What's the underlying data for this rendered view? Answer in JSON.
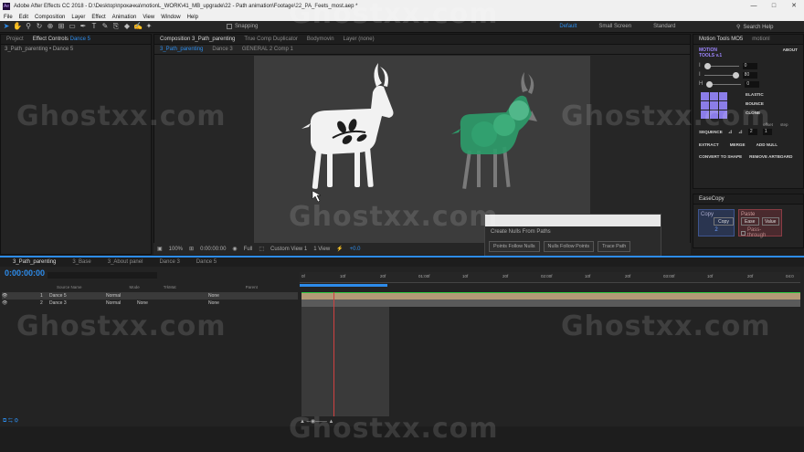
{
  "title_bar": {
    "app_icon": "Ae",
    "title": "Adobe After Effects CC 2018 - D:\\Desktop\\прокачка\\motionL_WORK\\41_MB_upgrade\\22 - Path animation\\Footage\\22_PA_Feets_most.aep *",
    "controls": [
      "—",
      "□",
      "✕"
    ]
  },
  "menu": [
    "File",
    "Edit",
    "Composition",
    "Layer",
    "Effect",
    "Animation",
    "View",
    "Window",
    "Help"
  ],
  "toolbar": {
    "snapping": "Snapping",
    "workspaces": [
      "Default",
      "Small Screen",
      "Standard"
    ],
    "active_workspace": "Default",
    "search_placeholder": "Search Help"
  },
  "project_panel": {
    "tab_project": "Project",
    "tab_effect_controls": "Effect Controls",
    "effect_controls_layer": "Dance 5",
    "breadcrumb": "3_Path_parenting • Dance 5"
  },
  "comp_panel": {
    "tabs": [
      "Composition 3_Path_parenting",
      "True Comp Duplicator",
      "Bodymovin",
      "Layer (none)"
    ],
    "subtabs": [
      "3_Path_parenting",
      "Dance 3",
      "GENERAL 2 Comp 1"
    ],
    "zoom": "100%",
    "timecode": "0:00:00:00",
    "resolution": "Full",
    "view": "Custom View 1",
    "views": "1 View",
    "exposure": "+0.0"
  },
  "motion_tools": {
    "tab": "Motion Tools MO5",
    "tab2": "motionl",
    "logo_line1": "MOTION",
    "logo_line2": "TOOLS v.1",
    "about": "ABOUT",
    "sliders": [
      {
        "label": "I",
        "value": "0"
      },
      {
        "label": "I",
        "value": "80"
      },
      {
        "label": "H",
        "value": "0"
      }
    ],
    "elastic": "ELASTIC",
    "bounce": "BOUNCE",
    "clone": "CLONE",
    "offset": "offset",
    "step": "step",
    "sequence": "SEQUENCE",
    "seq_v1": "2",
    "seq_v2": "1",
    "extract": "EXTRACT",
    "merge": "MERGE",
    "add_null": "ADD NULL",
    "convert": "CONVERT TO SHAPE",
    "remove_artboard": "REMOVE ARTBOARD"
  },
  "ease_copy": {
    "tab": "EaseCopy",
    "copy_title": "Copy",
    "copy_btn": "Copy",
    "copy_num": "2",
    "paste_title": "Paste",
    "ease_btn": "Ease",
    "value_btn": "Value",
    "pass_through": "Pass-through"
  },
  "nulls_dialog": {
    "title": "Create Nulls From Paths",
    "buttons": [
      "Points Follow Nulls",
      "Nulls Follow Points",
      "Trace Path"
    ]
  },
  "timeline": {
    "tabs": [
      "3_Path_parenting",
      "3_Base",
      "3_About panel",
      "Dance 3",
      "Dance 5"
    ],
    "timecode": "0:00:00:00",
    "columns": {
      "source": "Source Name",
      "mode": "Mode",
      "trkmat": "TrkMat",
      "parent": "Parent"
    },
    "layers": [
      {
        "num": "1",
        "name": "Dance 5",
        "mode": "Normal",
        "trkmat": "",
        "parent": "None"
      },
      {
        "num": "2",
        "name": "Dance 3",
        "mode": "Normal",
        "trkmat": "None",
        "parent": "None"
      }
    ],
    "ruler": [
      "0f",
      "10f",
      "20f",
      "01:00f",
      "10f",
      "20f",
      "02:00f",
      "10f",
      "20f",
      "03:00f",
      "10f",
      "20f",
      "04:0"
    ]
  },
  "watermark": "Ghostxx.com",
  "colors": {
    "accent": "#2d8ceb",
    "goat_white": "#f2f2f2",
    "goat_green": "#2e9b6a",
    "work_area": "#b49a76"
  }
}
